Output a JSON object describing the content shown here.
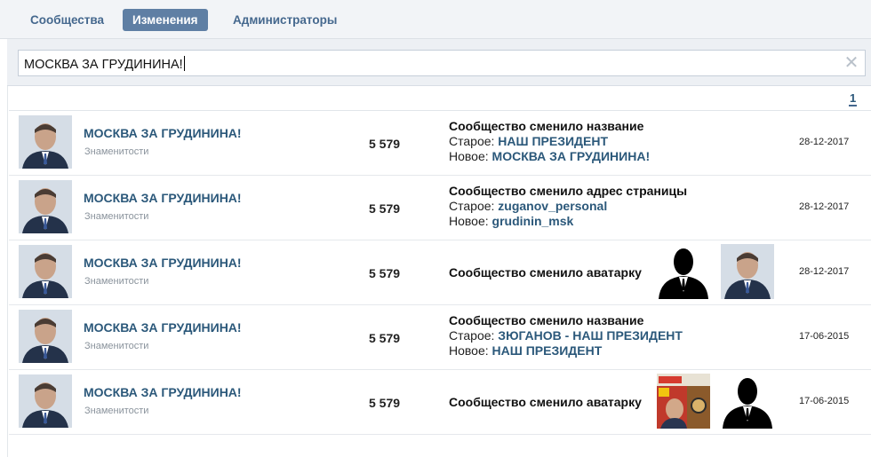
{
  "tabs": [
    {
      "label": "Сообщества"
    },
    {
      "label": "Изменения"
    },
    {
      "label": "Администраторы"
    }
  ],
  "search": {
    "value": "МОСКВА ЗА ГРУДИНИНА!"
  },
  "pager": {
    "current": "1"
  },
  "rows": [
    {
      "name": "МОСКВА ЗА ГРУДИНИНА!",
      "category": "Знаменитости",
      "members": "5 579",
      "change_title": "Сообщество сменило название",
      "old_label": "Старое:",
      "old_value": "НАШ ПРЕЗИДЕНТ",
      "new_label": "Новое:",
      "new_value": "МОСКВА ЗА ГРУДИНИНА!",
      "date": "28-12-2017"
    },
    {
      "name": "МОСКВА ЗА ГРУДИНИНА!",
      "category": "Знаменитости",
      "members": "5 579",
      "change_title": "Сообщество сменило адрес страницы",
      "old_label": "Старое:",
      "old_value": "zuganov_personal",
      "new_label": "Новое:",
      "new_value": "grudinin_msk",
      "date": "28-12-2017"
    },
    {
      "name": "МОСКВА ЗА ГРУДИНИНА!",
      "category": "Знаменитости",
      "members": "5 579",
      "change_title": "Сообщество сменило аватарку",
      "date": "28-12-2017"
    },
    {
      "name": "МОСКВА ЗА ГРУДИНИНА!",
      "category": "Знаменитости",
      "members": "5 579",
      "change_title": "Сообщество сменило название",
      "old_label": "Старое:",
      "old_value": "ЗЮГАНОВ - НАШ ПРЕЗИДЕНТ",
      "new_label": "Новое:",
      "new_value": "НАШ ПРЕЗИДЕНТ",
      "date": "17-06-2015"
    },
    {
      "name": "МОСКВА ЗА ГРУДИНИНА!",
      "category": "Знаменитости",
      "members": "5 579",
      "change_title": "Сообщество сменило аватарку",
      "date": "17-06-2015"
    }
  ],
  "colors": {
    "link": "#2b587a",
    "active_tab": "#5f7fa4",
    "topbar": "#f2f4f7"
  }
}
